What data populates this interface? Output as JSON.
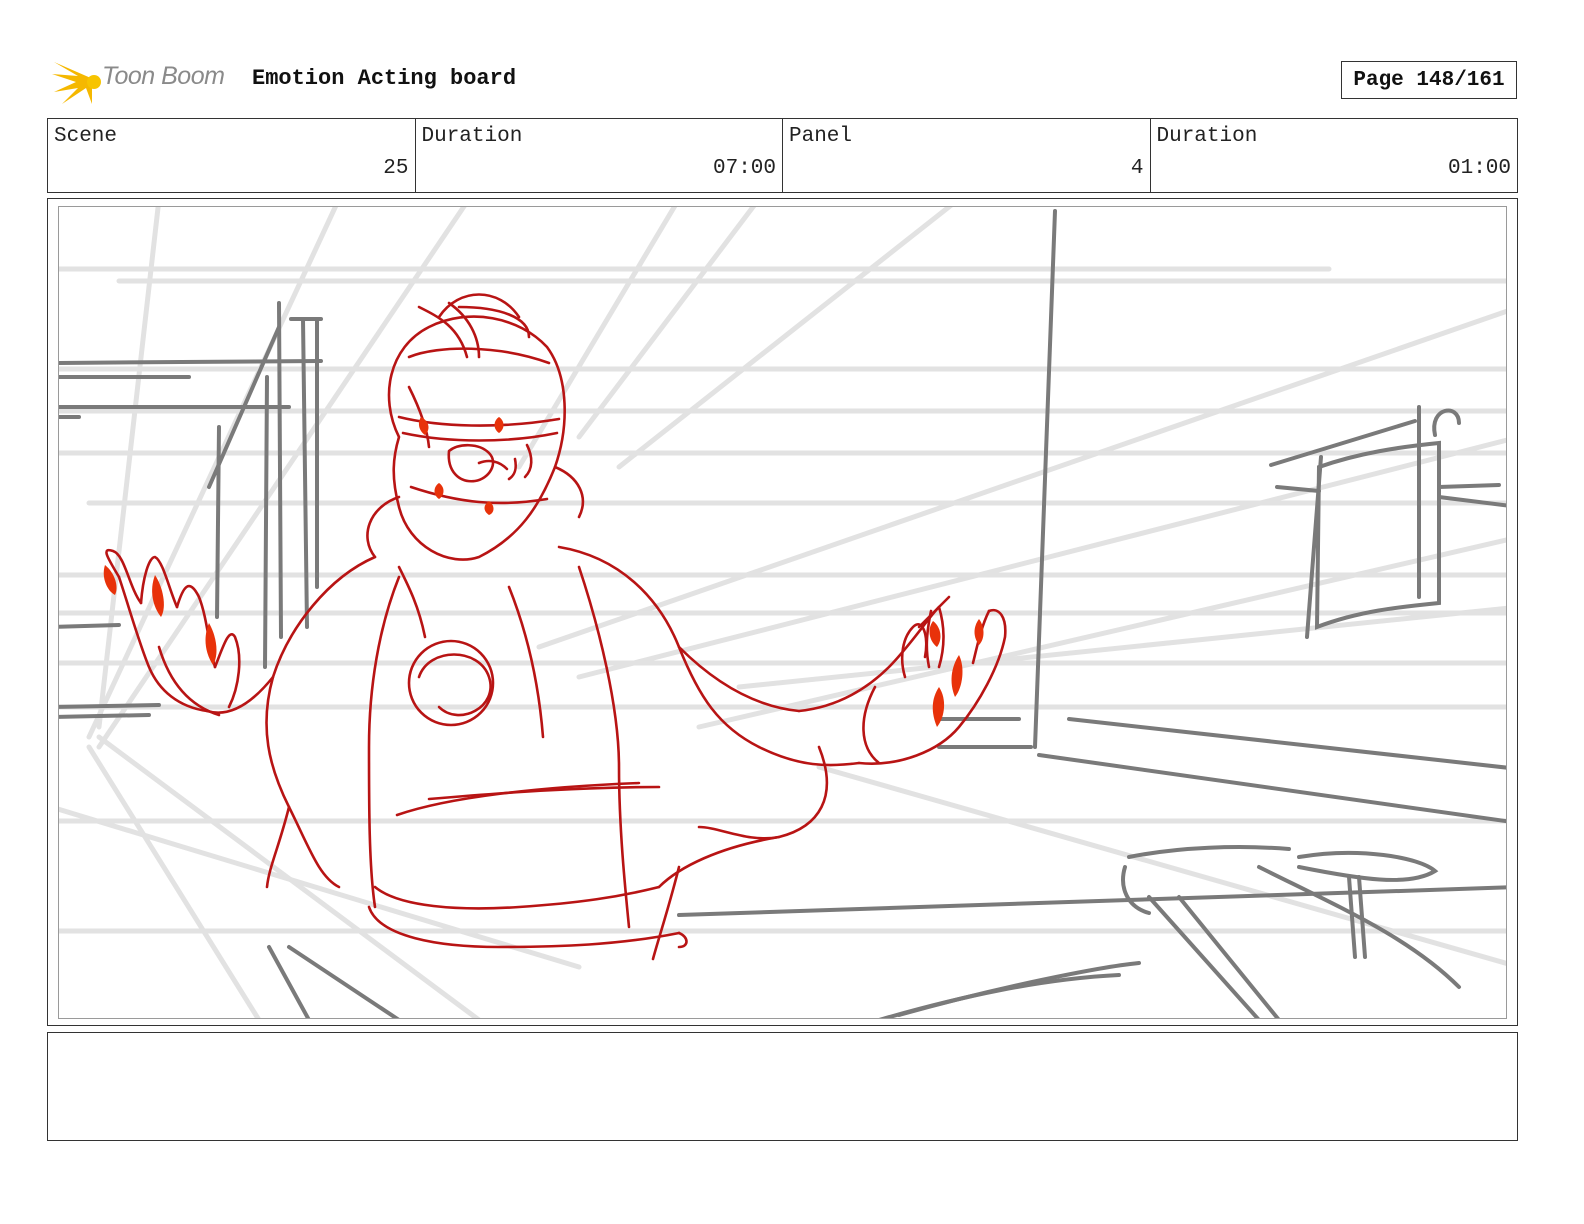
{
  "header": {
    "logo_text": "Toon Boom",
    "board_title": "Emotion Acting board",
    "page_label": "Page 148/161"
  },
  "info": {
    "scene_label": "Scene",
    "scene_value": "25",
    "scene_duration_label": "Duration",
    "scene_duration_value": "07:00",
    "panel_label": "Panel",
    "panel_value": "4",
    "panel_duration_label": "Duration",
    "panel_duration_value": "01:00"
  },
  "notes": {
    "text": ""
  },
  "colors": {
    "sketch_red": "#b81414",
    "sketch_fill": "#e8320a",
    "grey_line": "#777777",
    "light_line": "#e0e0e0",
    "logo_yellow": "#f5b800"
  },
  "icons": {
    "logo": "toon-boom-burst-icon"
  }
}
